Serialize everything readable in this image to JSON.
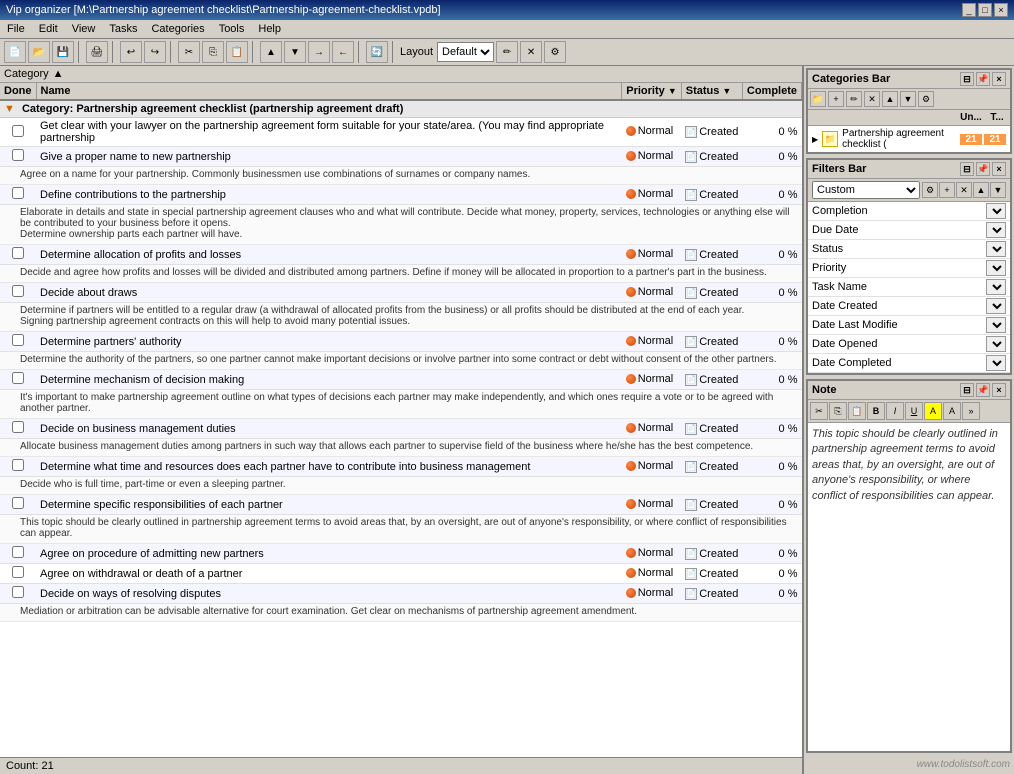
{
  "window": {
    "title": "Vip organizer [M:\\Partnership agreement checklist\\Partnership-agreement-checklist.vpdb]",
    "controls": [
      "_",
      "□",
      "×"
    ]
  },
  "menubar": {
    "items": [
      "File",
      "Edit",
      "View",
      "Tasks",
      "Categories",
      "Tools",
      "Help"
    ]
  },
  "toolbar": {
    "layout_label": "Layout"
  },
  "category_bar": {
    "label": "Category",
    "sort_icon": "▲"
  },
  "table": {
    "headers": {
      "done": "Done",
      "name": "Name",
      "priority": "Priority",
      "status": "Status",
      "complete": "Complete"
    },
    "category_row": "Category: Partnership agreement checklist (partnership agreement draft)",
    "rows": [
      {
        "id": 1,
        "checked": false,
        "name": "Get clear with your lawyer on the partnership agreement form suitable for your state/area. (You may find appropriate partnership",
        "detail": "",
        "priority": "Normal",
        "status": "Created",
        "complete": "0 %"
      },
      {
        "id": 2,
        "checked": false,
        "name": "Give a proper name to new partnership",
        "detail": "",
        "priority": "Normal",
        "status": "Created",
        "complete": "0 %"
      },
      {
        "id": 3,
        "checked": false,
        "name": "Agree on a name for your partnership. Commonly businessmen use combinations of surnames or company names.",
        "detail": "",
        "is_detail": true,
        "priority": "",
        "status": "",
        "complete": ""
      },
      {
        "id": 4,
        "checked": false,
        "name": "Define contributions to the partnership",
        "detail": "",
        "priority": "Normal",
        "status": "Created",
        "complete": "0 %"
      },
      {
        "id": 5,
        "is_detail": true,
        "name": "Elaborate in details and state in special partnership agreement clauses who and what will contribute. Decide what money, property, services, technologies or anything else will be contributed to your business before it opens.\nDetermine ownership parts each partner will have.",
        "priority": "",
        "status": "",
        "complete": ""
      },
      {
        "id": 6,
        "checked": false,
        "name": "Determine allocation of profits and losses",
        "priority": "Normal",
        "status": "Created",
        "complete": "0 %"
      },
      {
        "id": 7,
        "is_detail": true,
        "name": "Decide and agree how profits and losses will be divided and distributed among partners. Define if money will be allocated in proportion to a partner's part in the business.",
        "priority": "",
        "status": "",
        "complete": ""
      },
      {
        "id": 8,
        "checked": false,
        "name": "Decide about draws",
        "priority": "Normal",
        "status": "Created",
        "complete": "0 %"
      },
      {
        "id": 9,
        "is_detail": true,
        "name": "Determine if partners will be entitled to a regular draw (a withdrawal of allocated profits from the business) or all profits should be distributed at the end of each year.\nSigning partnership agreement contracts on this will help to avoid many potential issues.",
        "priority": "",
        "status": "",
        "complete": ""
      },
      {
        "id": 10,
        "checked": false,
        "name": "Determine partners' authority",
        "priority": "Normal",
        "status": "Created",
        "complete": "0 %"
      },
      {
        "id": 11,
        "is_detail": true,
        "name": "Determine the authority of the partners, so one partner cannot make important decisions or involve partner into some contract or debt without consent of the other partners.",
        "priority": "",
        "status": "",
        "complete": ""
      },
      {
        "id": 12,
        "checked": false,
        "name": "Determine mechanism of decision making",
        "priority": "Normal",
        "status": "Created",
        "complete": "0 %"
      },
      {
        "id": 13,
        "is_detail": true,
        "name": "It's important to make partnership agreement outline on what types of decisions each partner may make independently, and which ones require a vote or to be agreed with another partner.",
        "priority": "",
        "status": "",
        "complete": ""
      },
      {
        "id": 14,
        "checked": false,
        "name": "Decide on business management duties",
        "priority": "Normal",
        "status": "Created",
        "complete": "0 %"
      },
      {
        "id": 15,
        "is_detail": true,
        "name": "Allocate business management duties among partners in such way that allows each partner to supervise field of the business where he/she has the best competence.",
        "priority": "",
        "status": "",
        "complete": ""
      },
      {
        "id": 16,
        "checked": false,
        "name": "Determine what time and resources does each partner have to contribute into business management",
        "priority": "Normal",
        "status": "Created",
        "complete": "0 %"
      },
      {
        "id": 17,
        "is_detail": true,
        "name": "Decide who is full time, part-time or even a sleeping partner.",
        "priority": "",
        "status": "",
        "complete": ""
      },
      {
        "id": 18,
        "checked": false,
        "name": "Determine specific responsibilities of each partner",
        "priority": "Normal",
        "status": "Created",
        "complete": "0 %"
      },
      {
        "id": 19,
        "is_detail": true,
        "name": "This topic should be clearly outlined in partnership agreement terms to avoid areas that, by an oversight, are out of anyone's responsibility, or where conflict of responsibilities can appear.",
        "priority": "",
        "status": "",
        "complete": ""
      },
      {
        "id": 20,
        "checked": false,
        "name": "Agree on procedure of admitting new partners",
        "priority": "Normal",
        "status": "Created",
        "complete": "0 %"
      },
      {
        "id": 21,
        "checked": false,
        "name": "Agree on withdrawal or death of a partner",
        "priority": "Normal",
        "status": "Created",
        "complete": "0 %"
      },
      {
        "id": 22,
        "checked": false,
        "name": "Decide on ways of resolving disputes",
        "priority": "Normal",
        "status": "Created",
        "complete": "0 %"
      },
      {
        "id": 23,
        "is_detail": true,
        "name": "Mediation or arbitration can be advisable alternative for court examination. Get clear on mechanisms of partnership agreement amendment.",
        "priority": "",
        "status": "",
        "complete": ""
      }
    ]
  },
  "status_bar": {
    "count_label": "Count: 21"
  },
  "categories_panel": {
    "title": "Categories Bar",
    "col_un": "Un...",
    "col_t": "T...",
    "items": [
      {
        "name": "Partnership agreement checklist (",
        "un": "21",
        "t": "21"
      }
    ]
  },
  "filters_panel": {
    "title": "Filters Bar",
    "selected_filter": "Custom",
    "fields": [
      {
        "name": "Completion"
      },
      {
        "name": "Due Date"
      },
      {
        "name": "Status"
      },
      {
        "name": "Priority"
      },
      {
        "name": "Task Name"
      },
      {
        "name": "Date Created"
      },
      {
        "name": "Date Last Modifie"
      },
      {
        "name": "Date Opened"
      },
      {
        "name": "Date Completed"
      }
    ]
  },
  "note_panel": {
    "title": "Note",
    "text": "This topic should be clearly outlined in partnership agreement terms to avoid areas that, by an oversight, are out of anyone's responsibility, or where conflict of responsibilities can appear."
  },
  "watermark": "www.todolistsoft.com"
}
